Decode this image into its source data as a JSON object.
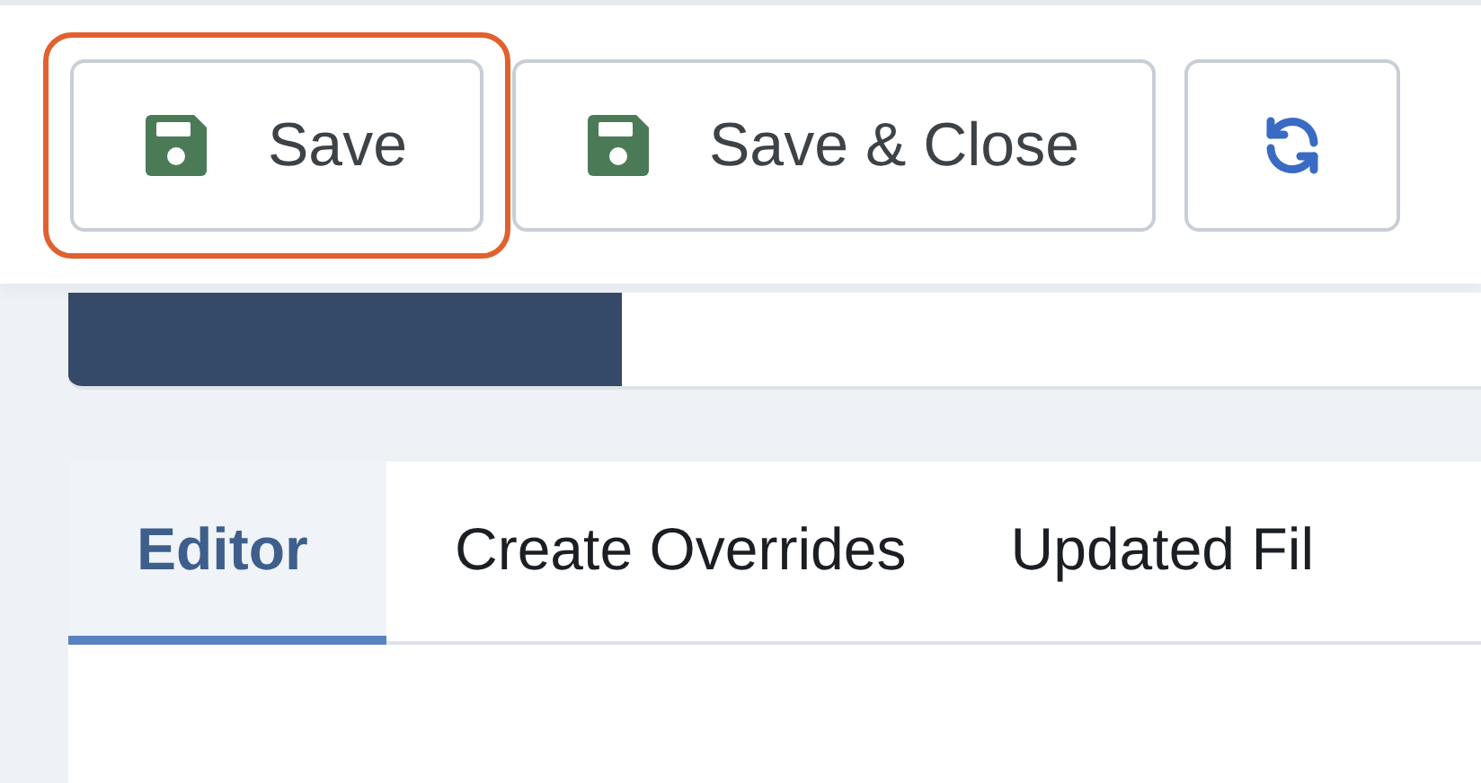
{
  "toolbar": {
    "buttons": [
      {
        "label": "Save",
        "kind": "save",
        "highlighted": true
      },
      {
        "label": "Save & Close",
        "kind": "save",
        "highlighted": false
      },
      {
        "kind": "refresh",
        "highlighted": false
      }
    ]
  },
  "tabs": [
    {
      "label": "Editor",
      "selected": true
    },
    {
      "label": "Create Overrides",
      "selected": false
    },
    {
      "label": "Updated Fil",
      "selected": false
    }
  ]
}
